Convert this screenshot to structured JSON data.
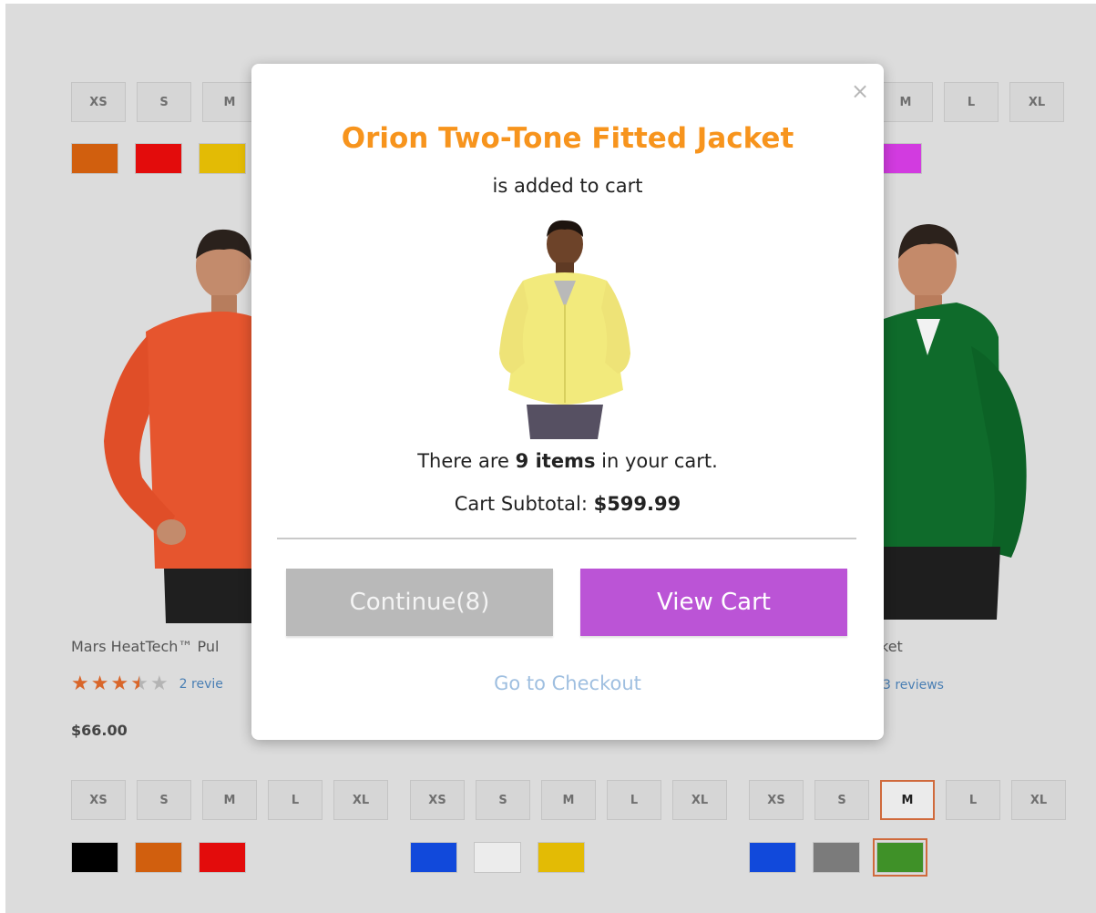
{
  "modal": {
    "close_glyph": "×",
    "title": "Orion Two-Tone Fitted Jacket",
    "subtitle": "is added to cart",
    "cart_prefix": "There are ",
    "cart_items": "9 items",
    "cart_suffix": " in your cart.",
    "subtotal_label": "Cart Subtotal: ",
    "subtotal_value": "$599.99",
    "continue_label": "Continue(8)",
    "view_cart_label": "View Cart",
    "checkout_label": "Go to Checkout",
    "title_color": "#f7941d",
    "view_cart_color": "#bb54d6"
  },
  "top_row": {
    "left_sizes": [
      "XS",
      "S",
      "M"
    ],
    "right_sizes": [
      "M",
      "L",
      "XL"
    ],
    "left_colors": [
      "#d15f0e",
      "#e30c0c",
      "#e3bb05"
    ],
    "right_colors": [
      "#d23be0"
    ]
  },
  "products": [
    {
      "name": "Mars HeatTech™ Pul",
      "rating": 3.5,
      "reviews": "2 revie",
      "price": "$66.00",
      "sizes": [
        "XS",
        "S",
        "M",
        "L",
        "XL"
      ],
      "colors": [
        "#000000",
        "#d15f0e",
        "#e30c0c"
      ]
    },
    {
      "name": "",
      "sizes": [
        "XS",
        "S",
        "M",
        "L",
        "XL"
      ],
      "colors": [
        "#1149db",
        "#ececec",
        "#e3bb05"
      ]
    },
    {
      "name": "ket",
      "reviews": "3 reviews",
      "sizes": [
        "XS",
        "S",
        "M",
        "L",
        "XL"
      ],
      "selected_size": "M",
      "colors": [
        "#1149db",
        "#7b7b7b",
        "#3f9128"
      ],
      "selected_color": "#3f9128"
    }
  ]
}
